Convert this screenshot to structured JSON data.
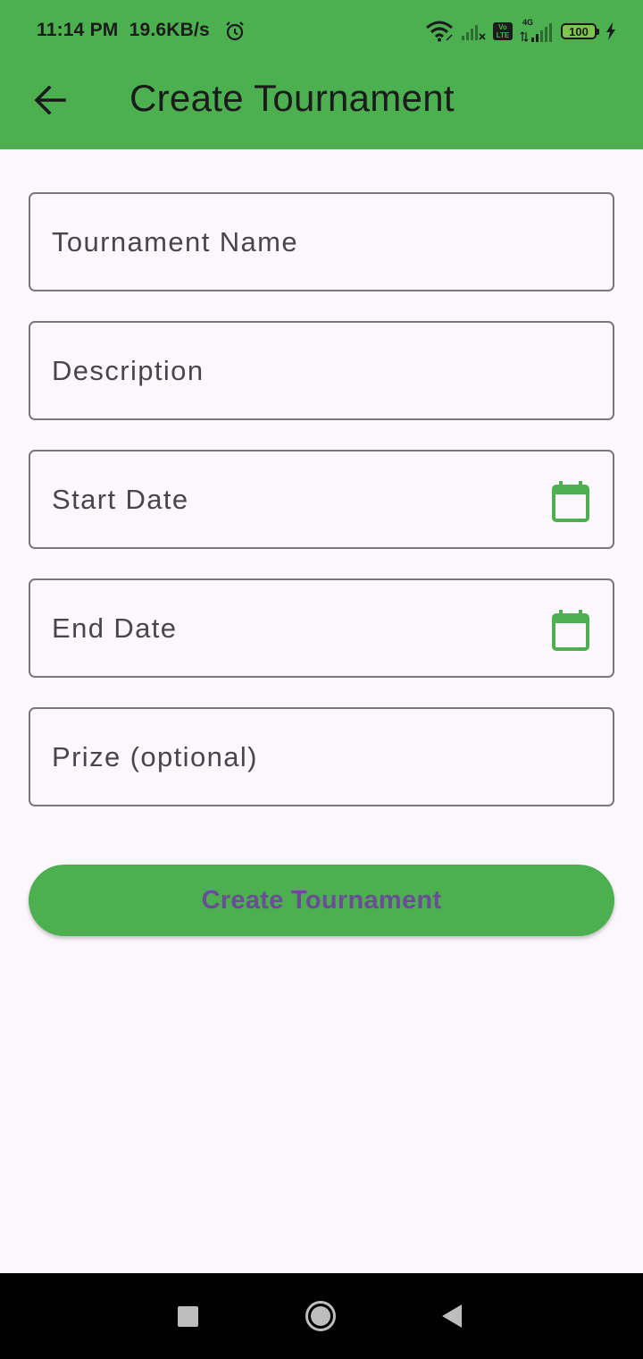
{
  "status_bar": {
    "time": "11:14 PM",
    "speed": "19.6KB/s",
    "battery": "100",
    "icons": [
      "alarm-icon",
      "wifi-icon",
      "signal-icon",
      "volte-icon",
      "4g-signal-icon",
      "battery-icon",
      "charging-icon"
    ],
    "volte_line1": "Vo",
    "volte_line2": "LTE",
    "network_type": "4G"
  },
  "app_bar": {
    "title": "Create Tournament",
    "back_icon": "arrow-back-icon",
    "background": "#4caf50"
  },
  "form": {
    "fields": [
      {
        "label": "Tournament Name"
      },
      {
        "label": "Description"
      },
      {
        "label": "Start Date",
        "icon": "calendar-icon"
      },
      {
        "label": "End Date",
        "icon": "calendar-icon"
      },
      {
        "label": "Prize (optional)"
      }
    ],
    "submit_label": "Create Tournament",
    "accent_color": "#4caf50"
  },
  "nav_bar": {
    "buttons": [
      "recent-apps-icon",
      "home-icon",
      "back-triangle-icon"
    ]
  }
}
